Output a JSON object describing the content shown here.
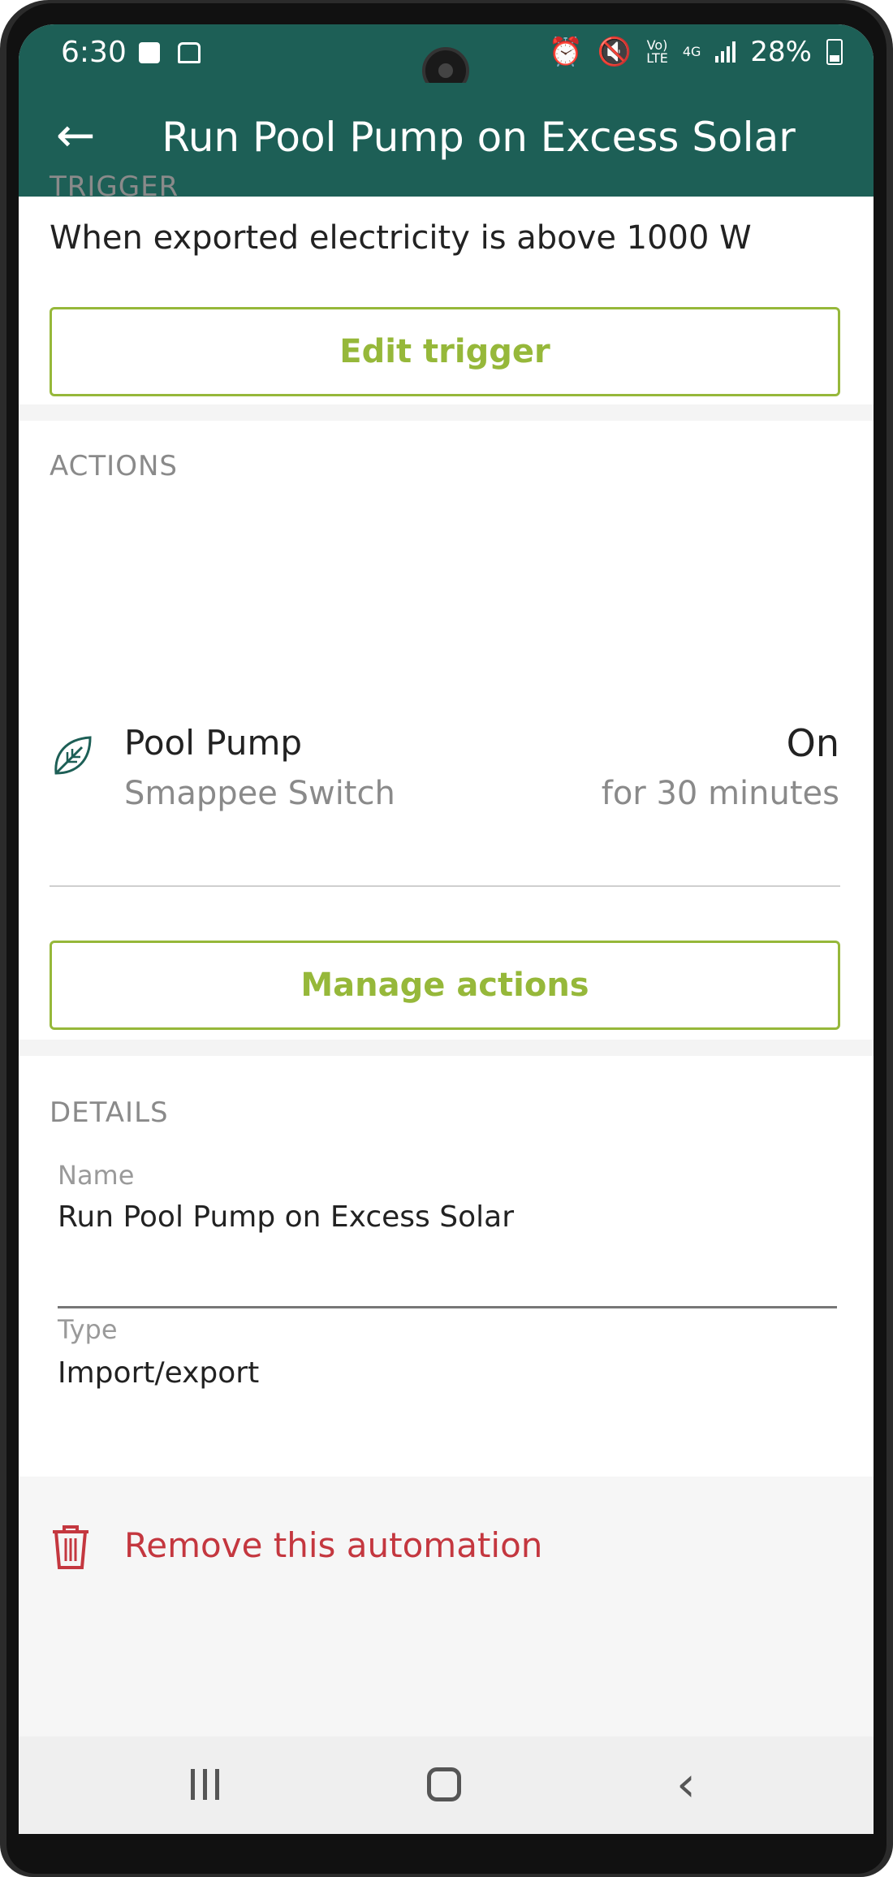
{
  "status_bar": {
    "time": "6:30",
    "battery": "28%",
    "volte_label": "Vo)\nLTE",
    "network_label": "4G"
  },
  "app_bar": {
    "title": "Run Pool Pump on Excess Solar",
    "back_icon": "arrow-left-icon"
  },
  "trigger": {
    "section_label": "TRIGGER",
    "description": "When exported electricity is above 1000 W",
    "edit_button": "Edit trigger"
  },
  "actions": {
    "section_label": "ACTIONS",
    "items": [
      {
        "name": "Pool Pump",
        "device_type": "Smappee Switch",
        "state": "On",
        "duration": "for 30 minutes",
        "icon": "leaf-icon"
      }
    ],
    "manage_button": "Manage actions"
  },
  "details": {
    "section_label": "DETAILS",
    "name_label": "Name",
    "name_value": "Run Pool Pump on Excess Solar",
    "type_label": "Type",
    "type_value": "Import/export"
  },
  "remove": {
    "label": "Remove this automation",
    "icon": "trash-icon"
  },
  "colors": {
    "header": "#1d5f56",
    "accent": "#96b83a",
    "danger": "#c4373f"
  }
}
